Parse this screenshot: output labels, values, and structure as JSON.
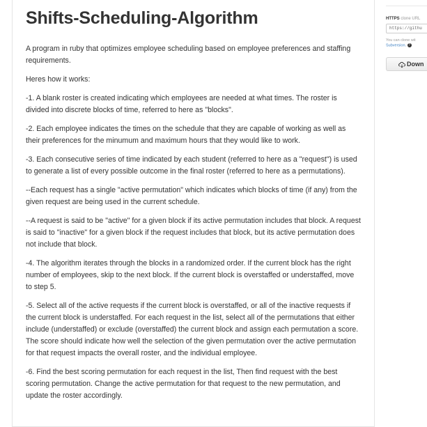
{
  "readme": {
    "title": "Shifts-Scheduling-Algorithm",
    "paragraphs": [
      "A program in ruby that optimizes employee scheduling based on employee preferences and staffing requirements.",
      "Heres how it works:",
      "-1. A blank roster is created indicating which employees are needed at what times. The roster is divided into discrete blocks of time, referred to here as \"blocks\".",
      "-2. Each employee indicates the times on the schedule that they are capable of working as well as their preferences for the minumum and maximum hours that they would like to work.",
      "-3. Each consecutive series of time indicated by each student (referred to here as a \"request\") is used to generate a list of every possible outcome in the final roster (referred to here as a permutations).",
      "--Each request has a single \"active permutation\" which indicates which blocks of time (if any) from the given request are being used in the current schedule.",
      "--A request is said to be \"active\" for a given block if its active permutation includes that block. A request is said to \"inactive\" for a given block if the request includes that block, but its active permutation does not include that block.",
      "-4. The algorithm iterates through the blocks in a randomized order. If the current block has the right number of employees, skip to the next block. If the current block is overstaffed or understaffed, move to step 5.",
      "-5. Select all of the active requests if the current block is overstaffed, or all of the inactive requests if the current block is understaffed. For each request in the list, select all of the permutations that either include (understaffed) or exclude (overstaffed) the current block and assign each permutation a score. The score should indicate how well the selection of the given permutation over the active permutation for that request impacts the overall roster, and the individual employee.",
      "-6. Find the best scoring permutation for each request in the list, Then find request with the best scoring permutation. Change the active permutation for that request to the new permutation, and update the roster accordingly."
    ]
  },
  "sidebar": {
    "clone_protocol": "HTTPS",
    "clone_label": "clone URL",
    "clone_url": "https://githu",
    "clone_help_text": "You can clone wit",
    "clone_help_link": "Subversion.",
    "help_icon": "question-circle-icon",
    "download_label": "Down",
    "download_icon": "download-cloud-icon"
  }
}
